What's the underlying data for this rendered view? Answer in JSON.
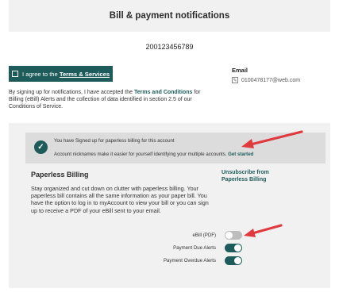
{
  "header": {
    "title": "Bill & payment notifications"
  },
  "account": {
    "number": "200123456789"
  },
  "agree": {
    "prefix": "I agree to the ",
    "link": "Terms & Services"
  },
  "email": {
    "label": "Email",
    "value": "0100478177@web.com"
  },
  "disclaimer": {
    "before": "By signing up for notifications, I have accepted the ",
    "link": "Terms and Conditions",
    "after": " for Billing (eBill) Alerts and the collection of data identified in section 2.5 of our Conditions of Service."
  },
  "notice": {
    "line1": "You have Signed up for paperless billing for this account",
    "line2": "Account nicknames make it easier for yourself identifying your multiple accounts. ",
    "link": "Get started"
  },
  "paperless": {
    "title": "Paperless Billing",
    "unsubscribe": "Unsubscribe from Paperless Billing",
    "description": "Stay organized and cut down on clutter with paperless billing. Your paperless bill contains all the same information as your paper bill. You have the option to log in to myAccount to view your bill or you can sign up to receive a PDF of your eBill sent to your email."
  },
  "toggles": [
    {
      "label": "eBill (PDF)",
      "state": "off"
    },
    {
      "label": "Payment Due Alerts",
      "state": "on"
    },
    {
      "label": "Payment Overdue Alerts",
      "state": "on"
    }
  ],
  "colors": {
    "accent": "#1d5c5b",
    "arrow": "#e03a3e",
    "panel": "#f1f1f1"
  }
}
